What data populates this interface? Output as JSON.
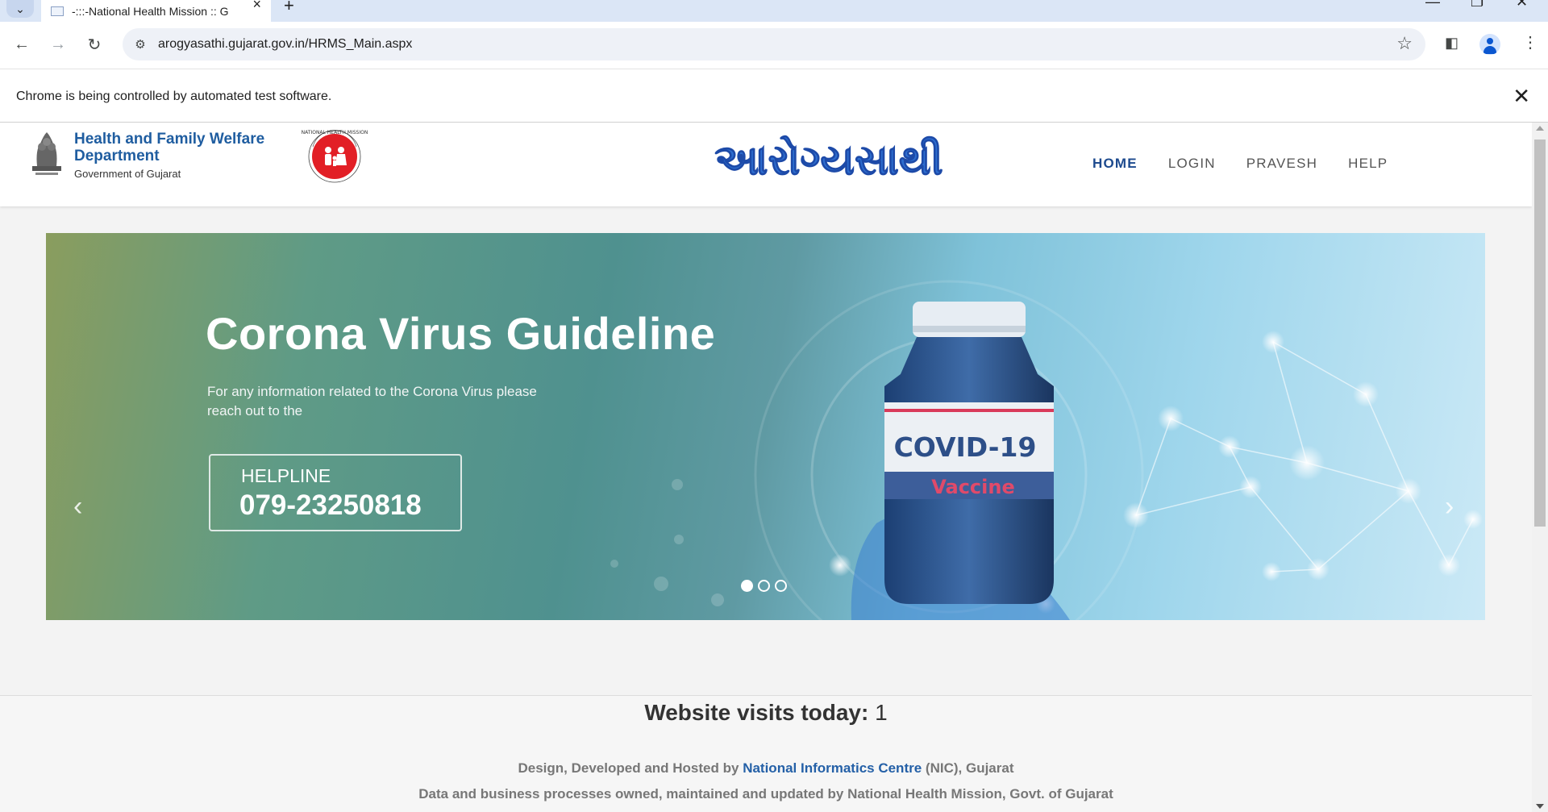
{
  "browser": {
    "tab_title": "-:::-National Health Mission :: G",
    "url": "arogyasathi.gujarat.gov.in/HRMS_Main.aspx",
    "infobar_text": "Chrome is being controlled by automated test software."
  },
  "header": {
    "dept_name": "Health and Family Welfare Department",
    "dept_sub": "Government of Gujarat",
    "nhm_ring_text": "NATIONAL HEALTH MISSION",
    "brand_text": "આરોગ્યસાથી"
  },
  "nav": {
    "items": [
      {
        "label": "HOME",
        "active": true
      },
      {
        "label": "LOGIN",
        "active": false
      },
      {
        "label": "PRAVESH",
        "active": false
      },
      {
        "label": "HELP",
        "active": false
      }
    ]
  },
  "carousel": {
    "slide_title": "Corona Virus Guideline",
    "slide_text": "For any information related to the Corona Virus please reach out to the",
    "helpline_label": "HELPLINE",
    "helpline_number": "079-23250818",
    "vial_label": "COVID-19",
    "vial_sub": "Vaccine",
    "prev": "‹",
    "next": "›",
    "slide_count": 3,
    "active_slide": 1
  },
  "footer": {
    "visits_label": "Website visits today:",
    "visits_count": "1",
    "credits_prefix": "Design, Developed and Hosted by",
    "credits_org": "National Informatics Centre",
    "credits_suffix": "(NIC), Gujarat",
    "owned_text": "Data and business processes owned, maintained and updated by National Health Mission, Govt. of Gujarat"
  },
  "colors": {
    "nav_active": "#1d4a8e",
    "dept_blue": "#1f5da0",
    "link_blue": "#2460a7",
    "brand_blue": "#2e6fd1"
  }
}
